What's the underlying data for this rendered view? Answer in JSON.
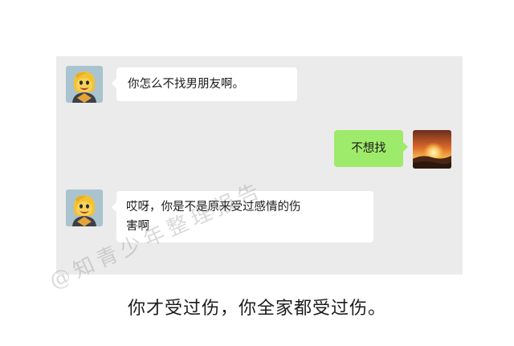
{
  "chat": {
    "messages": [
      {
        "side": "left",
        "avatar": "cartoon-avatar",
        "text": "你怎么不找男朋友啊。"
      },
      {
        "side": "right",
        "avatar": "sunset-avatar",
        "text": "不想找"
      },
      {
        "side": "left",
        "avatar": "cartoon-avatar",
        "lines": [
          "哎呀，你是不是原来受过感情的伤",
          "害啊"
        ]
      }
    ]
  },
  "caption": "你才受过伤，你全家都受过伤。",
  "watermark": "@知青少年整理报告",
  "colors": {
    "panel": "#ebebeb",
    "bubble_in": "#ffffff",
    "bubble_out": "#9eea6a"
  }
}
